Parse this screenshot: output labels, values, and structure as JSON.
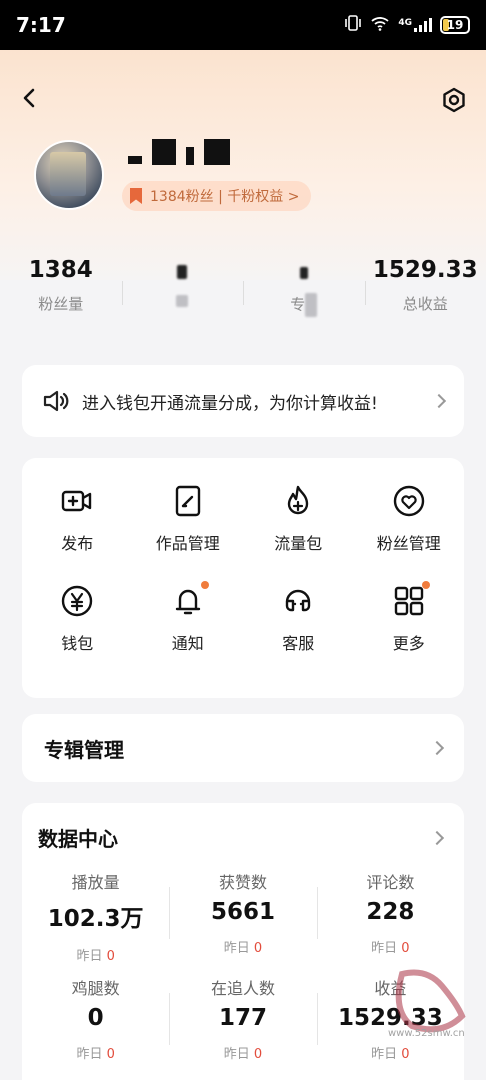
{
  "status_bar": {
    "time": "7:17",
    "network": "4G",
    "battery": "19"
  },
  "profile": {
    "fans_chip": "1384粉丝 | 千粉权益 >"
  },
  "stats": [
    {
      "value": "1384",
      "label": "粉丝量"
    },
    {
      "value": "",
      "label": ""
    },
    {
      "value": "",
      "label": "专"
    },
    {
      "value": "1529.33",
      "label": "总收益"
    }
  ],
  "announcement": {
    "text": "进入钱包开通流量分成，为你计算收益!"
  },
  "grid": [
    {
      "label": "发布",
      "icon": "video-add-icon",
      "dot": false
    },
    {
      "label": "作品管理",
      "icon": "edit-icon",
      "dot": false
    },
    {
      "label": "流量包",
      "icon": "flame-plus-icon",
      "dot": false
    },
    {
      "label": "粉丝管理",
      "icon": "heart-icon",
      "dot": false
    },
    {
      "label": "钱包",
      "icon": "yen-icon",
      "dot": false
    },
    {
      "label": "通知",
      "icon": "bell-icon",
      "dot": true
    },
    {
      "label": "客服",
      "icon": "headset-icon",
      "dot": false
    },
    {
      "label": "更多",
      "icon": "grid-icon",
      "dot": true
    }
  ],
  "album": {
    "title": "专辑管理"
  },
  "data_center": {
    "title": "数据中心",
    "metrics": [
      {
        "label": "播放量",
        "value": "102.3万",
        "delta_label": "昨日",
        "delta": "0"
      },
      {
        "label": "获赞数",
        "value": "5661",
        "delta_label": "昨日",
        "delta": "0"
      },
      {
        "label": "评论数",
        "value": "228",
        "delta_label": "昨日",
        "delta": "0"
      },
      {
        "label": "鸡腿数",
        "value": "0",
        "delta_label": "昨日",
        "delta": "0"
      },
      {
        "label": "在追人数",
        "value": "177",
        "delta_label": "昨日",
        "delta": "0"
      },
      {
        "label": "收益",
        "value": "1529.33",
        "delta_label": "昨日",
        "delta": "0"
      }
    ]
  },
  "watermark": {
    "text": "www.52smw.cn"
  },
  "colors": {
    "accent": "#e6683b",
    "dot": "#f07c3c",
    "delta": "#e24c3c"
  }
}
